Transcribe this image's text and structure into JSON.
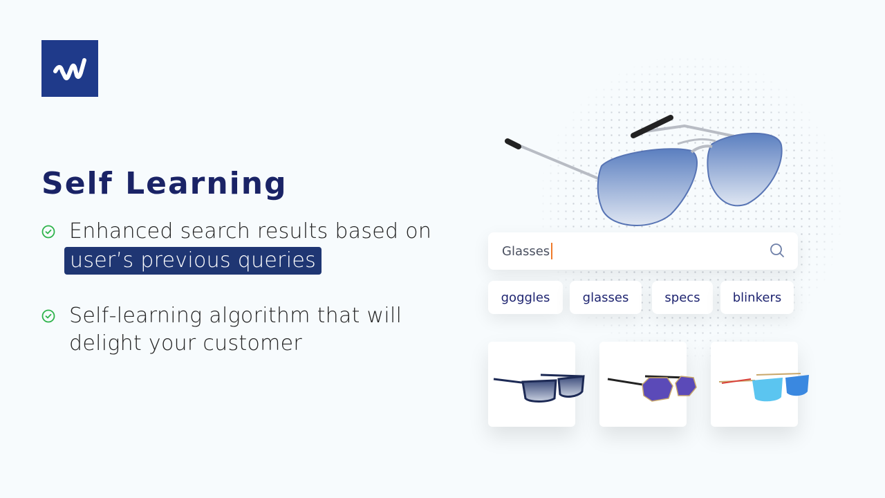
{
  "brand": {
    "logo_icon": "w-logo-icon",
    "logo_color": "#1f3a8a"
  },
  "headline": "Self Learning",
  "features": [
    {
      "icon": "check-circle-icon",
      "text_before": "Enhanced search results based on",
      "highlight": "user’s previous queries"
    },
    {
      "icon": "check-circle-icon",
      "line1": "Self-learning algorithm that will",
      "line2": "delight your customer"
    }
  ],
  "demo": {
    "hero_image": "aviator-sunglasses-image",
    "search": {
      "value": "Glasses",
      "icon": "search-icon"
    },
    "suggestions": [
      "goggles",
      "glasses",
      "specs",
      "blinkers"
    ],
    "products": [
      {
        "image": "navy-wayfarer-sunglasses"
      },
      {
        "image": "purple-hexagon-sunglasses"
      },
      {
        "image": "blue-mirror-square-sunglasses"
      }
    ]
  },
  "colors": {
    "accent": "#1f3673",
    "title": "#1a2366",
    "check": "#2db34a",
    "caret": "#f07a2a"
  }
}
